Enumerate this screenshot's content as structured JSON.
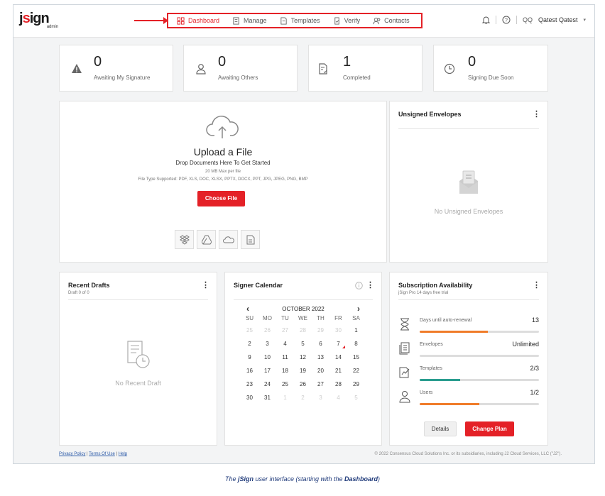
{
  "app": {
    "logo_main": "jsign",
    "logo_sub": "admin"
  },
  "nav": [
    {
      "label": "Dashboard",
      "icon": "dashboard-icon"
    },
    {
      "label": "Manage",
      "icon": "manage-icon"
    },
    {
      "label": "Templates",
      "icon": "templates-icon"
    },
    {
      "label": "Verify",
      "icon": "verify-icon"
    },
    {
      "label": "Contacts",
      "icon": "contacts-icon"
    }
  ],
  "user": {
    "initials": "QQ",
    "name": "Qatest Qatest"
  },
  "stats": [
    {
      "count": "0",
      "label": "Awaiting My Signature"
    },
    {
      "count": "0",
      "label": "Awaiting Others"
    },
    {
      "count": "1",
      "label": "Completed"
    },
    {
      "count": "0",
      "label": "Signing Due Soon"
    }
  ],
  "upload": {
    "title": "Upload a File",
    "subtitle": "Drop Documents Here To Get Started",
    "max": "20 MB Max per file",
    "types": "File Type Supported: PDF, XLS, DOC, XLSX, PPTX, DOCX, PPT, JPG, JPEG, PNG, BMP",
    "button": "Choose File"
  },
  "unsigned": {
    "title": "Unsigned Envelopes",
    "empty": "No Unsigned Envelopes"
  },
  "drafts": {
    "title": "Recent Drafts",
    "subtitle": "Draft 0 of 0",
    "empty": "No Recent Draft"
  },
  "calendar": {
    "title": "Signer Calendar",
    "month": "OCTOBER 2022",
    "days": [
      "SU",
      "MO",
      "TU",
      "WE",
      "TH",
      "FR",
      "SA"
    ],
    "weeks": [
      [
        "25",
        "26",
        "27",
        "28",
        "29",
        "30",
        "1"
      ],
      [
        "2",
        "3",
        "4",
        "5",
        "6",
        "7",
        "8"
      ],
      [
        "9",
        "10",
        "11",
        "12",
        "13",
        "14",
        "15"
      ],
      [
        "16",
        "17",
        "18",
        "19",
        "20",
        "21",
        "22"
      ],
      [
        "23",
        "24",
        "25",
        "26",
        "27",
        "28",
        "29"
      ],
      [
        "30",
        "31",
        "1",
        "2",
        "3",
        "4",
        "5"
      ]
    ]
  },
  "subscription": {
    "title": "Subscription Availability",
    "subtitle": "jSign Pro 14 days free trial",
    "rows": [
      {
        "name": "Days until auto-renewal",
        "value": "13",
        "fill": 0.57,
        "color": "#f07c2a"
      },
      {
        "name": "Envelopes",
        "value": "Unlimited",
        "fill": 0,
        "color": "#f07c2a"
      },
      {
        "name": "Templates",
        "value": "2/3",
        "fill": 0.34,
        "color": "#2a9d8f"
      },
      {
        "name": "Users",
        "value": "1/2",
        "fill": 0.5,
        "color": "#f07c2a"
      }
    ],
    "details": "Details",
    "change_plan": "Change Plan"
  },
  "footer": {
    "privacy": "Privacy Policy",
    "terms": "Terms Of Use",
    "help": "Help",
    "copyright": "© 2022 Consensus Cloud Solutions Inc. or its subsidiaries, including J2 Cloud Services, LLC (\"J2\")."
  },
  "caption": {
    "pre": "The ",
    "brand": "jSign",
    "mid": " user interface (starting with the ",
    "page": "Dashboard",
    "post": ")"
  },
  "colors": {
    "accent": "#e42127",
    "orange": "#f07c2a",
    "teal": "#2a9d8f"
  }
}
